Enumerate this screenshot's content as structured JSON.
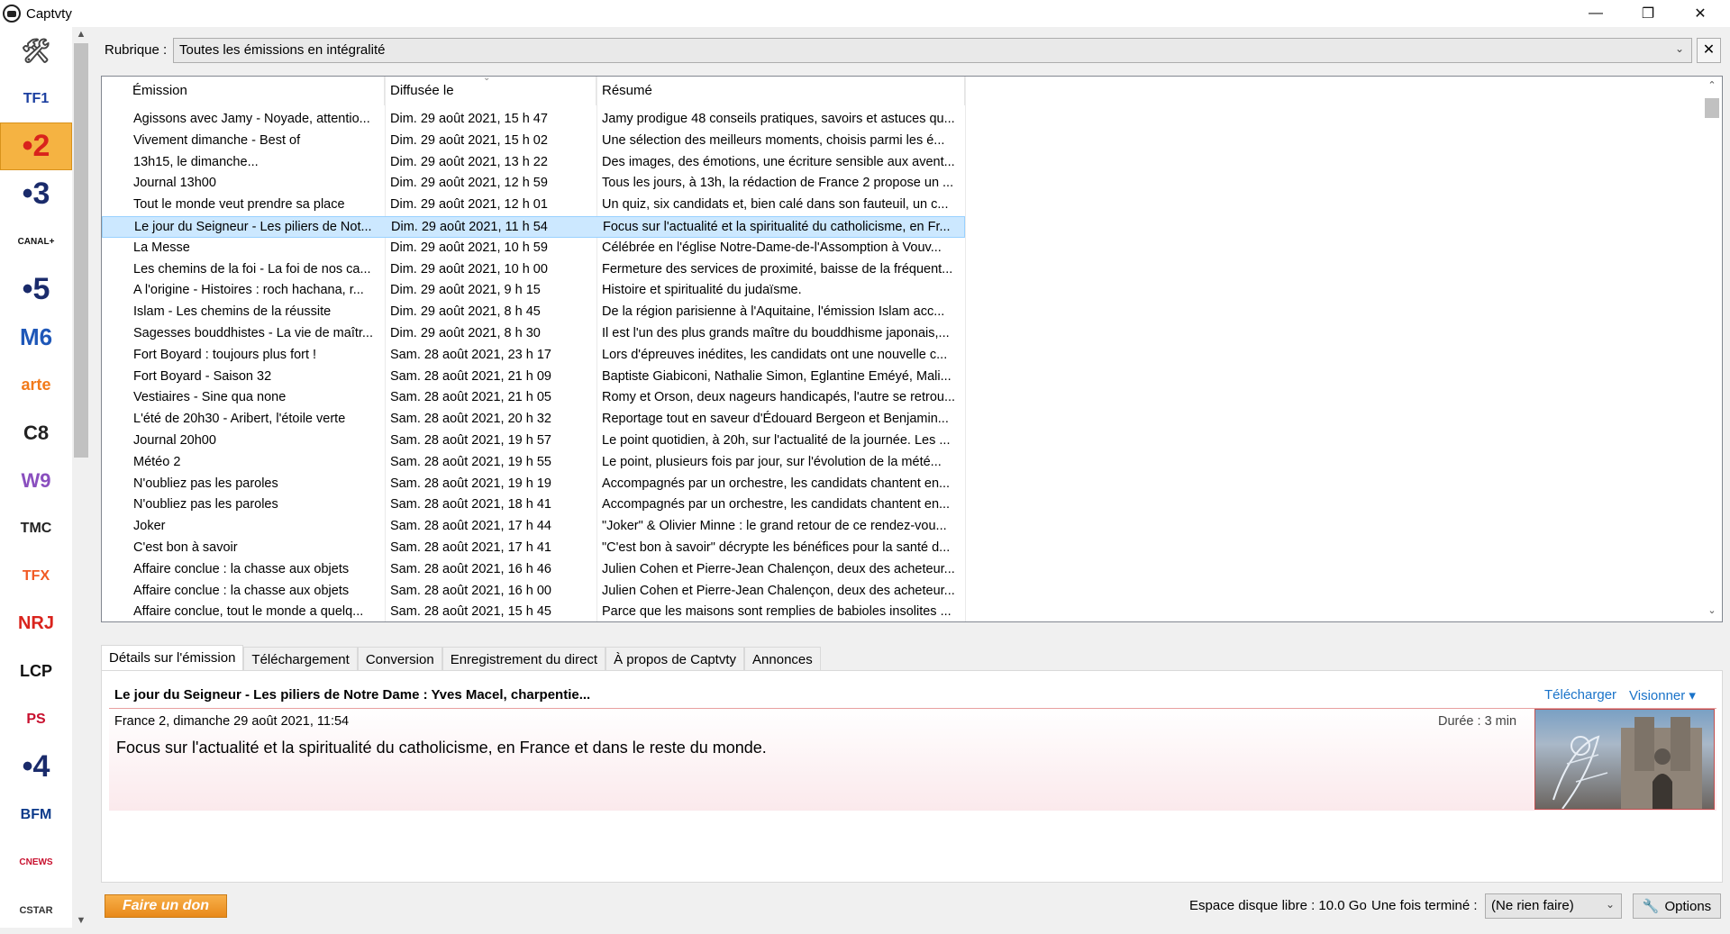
{
  "window": {
    "title": "Captvty",
    "minimize": "—",
    "maximize": "❐",
    "close": "✕"
  },
  "channels": [
    {
      "name": "tool-icon",
      "label": "🛠",
      "color": "#444444",
      "size": "26px"
    },
    {
      "name": "tf1",
      "label": "TF1",
      "color": "#1b3fa0",
      "size": "16px"
    },
    {
      "name": "france-2",
      "label": "•2",
      "color": "#d9231c",
      "size": "34px",
      "selected": true
    },
    {
      "name": "france-3",
      "label": "•3",
      "color": "#1a2b6b",
      "size": "34px"
    },
    {
      "name": "canal-plus",
      "label": "CANAL+",
      "color": "#111111",
      "size": "10px"
    },
    {
      "name": "france-5",
      "label": "•5",
      "color": "#1a2b6b",
      "size": "34px"
    },
    {
      "name": "m6",
      "label": "M6",
      "color": "#1e57b8",
      "size": "26px"
    },
    {
      "name": "arte",
      "label": "arte",
      "color": "#f27a1a",
      "size": "18px"
    },
    {
      "name": "c8",
      "label": "C8",
      "color": "#222222",
      "size": "22px"
    },
    {
      "name": "w9",
      "label": "W9",
      "color": "#8a4fbf",
      "size": "22px"
    },
    {
      "name": "tmc",
      "label": "TMC",
      "color": "#222222",
      "size": "16px"
    },
    {
      "name": "tfx",
      "label": "TFX",
      "color": "#f15a24",
      "size": "16px"
    },
    {
      "name": "nrj12",
      "label": "NRJ",
      "color": "#d9231c",
      "size": "20px"
    },
    {
      "name": "lcp",
      "label": "LCP",
      "color": "#111111",
      "size": "18px"
    },
    {
      "name": "public-senat",
      "label": "PS",
      "color": "#c8102e",
      "size": "16px"
    },
    {
      "name": "france-4",
      "label": "•4",
      "color": "#1a2b6b",
      "size": "34px"
    },
    {
      "name": "bfmtv",
      "label": "BFM",
      "color": "#0c3a8a",
      "size": "16px"
    },
    {
      "name": "cnews",
      "label": "CNEWS",
      "color": "#c8102e",
      "size": "10px"
    },
    {
      "name": "cstar",
      "label": "CSTAR",
      "color": "#333333",
      "size": "11px"
    }
  ],
  "rubrique": {
    "label": "Rubrique :",
    "value": "Toutes les émissions en intégralité",
    "close": "✕"
  },
  "grid": {
    "columns": [
      "Émission",
      "Diffusée le",
      "Résumé"
    ],
    "rows": [
      [
        "Agissons avec Jamy - Noyade, attentio...",
        "Dim. 29 août 2021, 15 h 47",
        "Jamy prodigue 48 conseils pratiques, savoirs et astuces qu..."
      ],
      [
        "Vivement dimanche - Best of",
        "Dim. 29 août 2021, 15 h 02",
        "Une sélection des meilleurs moments, choisis parmi les é..."
      ],
      [
        "13h15, le dimanche...",
        "Dim. 29 août 2021, 13 h 22",
        "Des images, des émotions, une écriture sensible aux avent..."
      ],
      [
        "Journal 13h00",
        "Dim. 29 août 2021, 12 h 59",
        "Tous les jours, à 13h, la rédaction de France 2 propose un ..."
      ],
      [
        "Tout le monde veut prendre sa place",
        "Dim. 29 août 2021, 12 h 01",
        "Un quiz, six candidats et, bien calé dans son fauteuil, un c..."
      ],
      [
        "Le jour du Seigneur - Les piliers de Not...",
        "Dim. 29 août 2021, 11 h 54",
        "Focus sur l'actualité et la spiritualité du catholicisme, en Fr..."
      ],
      [
        "La Messe",
        "Dim. 29 août 2021, 10 h 59",
        "Célébrée en l'église Notre-Dame-de-l'Assomption à Vouv..."
      ],
      [
        "Les chemins de la foi - La foi de nos ca...",
        "Dim. 29 août 2021, 10 h 00",
        "Fermeture des services de proximité, baisse de la fréquent..."
      ],
      [
        "A l'origine - Histoires : roch hachana, r...",
        "Dim. 29 août 2021, 9 h 15",
        "Histoire et spiritualité du judaïsme."
      ],
      [
        "Islam - Les chemins de la réussite",
        "Dim. 29 août 2021, 8 h 45",
        "De la région parisienne à l'Aquitaine, l'émission Islam acc..."
      ],
      [
        "Sagesses bouddhistes - La vie de maîtr...",
        "Dim. 29 août 2021, 8 h 30",
        "Il est l'un des plus grands maître du bouddhisme japonais,..."
      ],
      [
        "Fort Boyard : toujours plus fort !",
        "Sam. 28 août 2021, 23 h 17",
        "Lors d'épreuves inédites, les candidats ont une nouvelle c..."
      ],
      [
        "Fort Boyard - Saison 32",
        "Sam. 28 août 2021, 21 h 09",
        "Baptiste Giabiconi, Nathalie Simon, Eglantine Eméyé, Mali..."
      ],
      [
        "Vestiaires - Sine qua none",
        "Sam. 28 août 2021, 21 h 05",
        "Romy et Orson, deux nageurs handicapés, l'autre se retrou..."
      ],
      [
        "L'été de 20h30 - Aribert, l'étoile verte",
        "Sam. 28 août 2021, 20 h 32",
        "Reportage tout en saveur d'Édouard Bergeon et Benjamin..."
      ],
      [
        "Journal 20h00",
        "Sam. 28 août 2021, 19 h 57",
        "Le point quotidien, à 20h, sur l'actualité de la journée. Les ..."
      ],
      [
        "Météo 2",
        "Sam. 28 août 2021, 19 h 55",
        "Le point, plusieurs fois par jour, sur l'évolution de la mété..."
      ],
      [
        "N'oubliez pas les paroles",
        "Sam. 28 août 2021, 19 h 19",
        "Accompagnés par un orchestre, les candidats chantent en..."
      ],
      [
        "N'oubliez pas les paroles",
        "Sam. 28 août 2021, 18 h 41",
        "Accompagnés par un orchestre, les candidats chantent en..."
      ],
      [
        "Joker",
        "Sam. 28 août 2021, 17 h 44",
        "\"Joker\" & Olivier Minne : le grand retour de ce rendez-vou..."
      ],
      [
        "C'est bon à savoir",
        "Sam. 28 août 2021, 17 h 41",
        "\"C'est bon à savoir\" décrypte les bénéfices pour la santé d..."
      ],
      [
        "Affaire conclue : la chasse aux objets",
        "Sam. 28 août 2021, 16 h 46",
        "Julien Cohen et Pierre-Jean Chalençon, deux des acheteur..."
      ],
      [
        "Affaire conclue : la chasse aux objets",
        "Sam. 28 août 2021, 16 h 00",
        "Julien Cohen et Pierre-Jean Chalençon, deux des acheteur..."
      ],
      [
        "Affaire conclue, tout le monde a quelq...",
        "Sam. 28 août 2021, 15 h 45",
        "Parce que les maisons sont remplies de babioles insolites ..."
      ]
    ],
    "selected_row": 5
  },
  "tabs": [
    "Détails sur l'émission",
    "Téléchargement",
    "Conversion",
    "Enregistrement du direct",
    "À propos de Captvty",
    "Annonces"
  ],
  "details": {
    "title": "Le jour du Seigneur - Les piliers de Notre Dame : Yves Macel, charpentie...",
    "download": "Télécharger",
    "watch": "Visionner ▾",
    "meta": "France 2, dimanche 29 août 2021, 11:54",
    "duration": "Durée : 3 min",
    "summary": "Focus sur l'actualité et la spiritualité du catholicisme, en France et dans le reste du monde."
  },
  "status": {
    "donate": "Faire un don",
    "disk": "Espace disque libre : 10.0 Go",
    "after_label": "Une fois terminé :",
    "after_value": "(Ne rien faire)",
    "options": "Options"
  },
  "colors": {
    "accent": "#f5b342",
    "link": "#1a73c9",
    "selection": "#cce8ff"
  }
}
